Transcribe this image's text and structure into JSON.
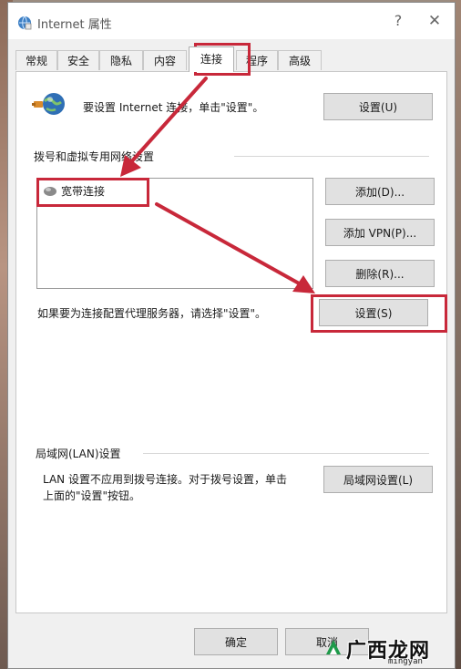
{
  "window": {
    "title": "Internet 属性",
    "help_glyph": "?",
    "close_glyph": "✕"
  },
  "tabs": [
    {
      "label": "常规",
      "active": false
    },
    {
      "label": "安全",
      "active": false
    },
    {
      "label": "隐私",
      "active": false
    },
    {
      "label": "内容",
      "active": false
    },
    {
      "label": "连接",
      "active": true
    },
    {
      "label": "程序",
      "active": false
    },
    {
      "label": "高级",
      "active": false
    }
  ],
  "setup": {
    "text": "要设置 Internet 连接，单击\"设置\"。",
    "button": "设置(U)",
    "icon": "globe-network-icon"
  },
  "dialup": {
    "section_title": "拨号和虚拟专用网络设置",
    "connections": [
      {
        "name": "宽带连接",
        "icon": "broadband-connection-icon"
      }
    ],
    "add_button": "添加(D)...",
    "add_vpn_button": "添加 VPN(P)...",
    "remove_button": "删除(R)...",
    "proxy_text": "如果要为连接配置代理服务器，请选择\"设置\"。",
    "settings_button": "设置(S)"
  },
  "lan": {
    "section_title": "局域网(LAN)设置",
    "description_line1": "LAN 设置不应用到拨号连接。对于拨号设置，单击",
    "description_line2": "上面的\"设置\"按钮。",
    "button": "局域网设置(L)"
  },
  "footer": {
    "ok": "确定",
    "cancel": "取消"
  },
  "annotation": {
    "color": "#c8283a"
  },
  "watermark": {
    "text": "广西龙网",
    "sub": "mingyan"
  }
}
